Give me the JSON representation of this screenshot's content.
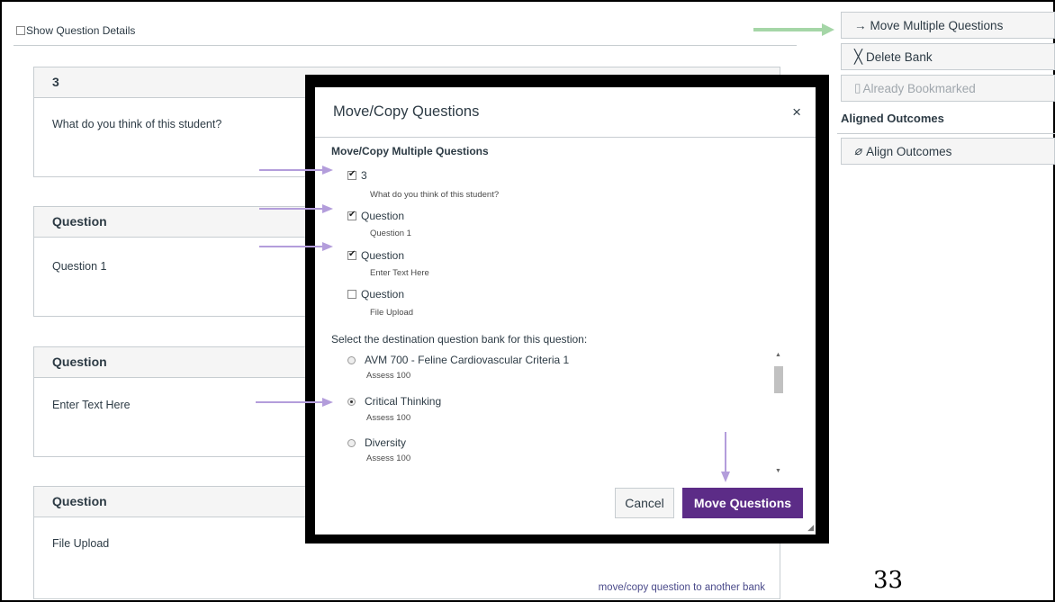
{
  "header": {
    "show_details_label": "Show Question Details"
  },
  "questions": [
    {
      "title": "3",
      "text": "What do you think of this student?"
    },
    {
      "title": "Question",
      "text": "Question 1"
    },
    {
      "title": "Question",
      "text": "Enter Text Here"
    },
    {
      "title": "Question",
      "text": "File Upload",
      "link": "move/copy question to another bank"
    }
  ],
  "sidebar": {
    "move_multiple": "Move Multiple Questions",
    "delete_bank": "Delete Bank",
    "already_bookmarked": "Already Bookmarked",
    "aligned_outcomes_title": "Aligned Outcomes",
    "align_outcomes": "Align Outcomes"
  },
  "dialog": {
    "title": "Move/Copy Questions",
    "close": "×",
    "subtitle": "Move/Copy Multiple Questions",
    "items": [
      {
        "label": "3",
        "desc": "What do you think of this student?",
        "checked": true
      },
      {
        "label": "Question",
        "desc": "Question 1",
        "checked": true
      },
      {
        "label": "Question",
        "desc": "Enter Text Here",
        "checked": true
      },
      {
        "label": "Question",
        "desc": "File Upload",
        "checked": false
      }
    ],
    "destination_label": "Select the destination question bank for this question:",
    "banks": [
      {
        "name": "AVM 700 - Feline Cardiovascular Criteria 1",
        "sub": "Assess 100",
        "selected": false
      },
      {
        "name": "Critical Thinking",
        "sub": "Assess 100",
        "selected": true
      },
      {
        "name": "Diversity",
        "sub": "Assess 100",
        "selected": false
      }
    ],
    "cancel": "Cancel",
    "submit": "Move Questions"
  },
  "page_number": "33",
  "colors": {
    "primary": "#5c2c87",
    "annotation_arrow": "#b39ddb",
    "green_arrow": "#a5d6a7"
  }
}
